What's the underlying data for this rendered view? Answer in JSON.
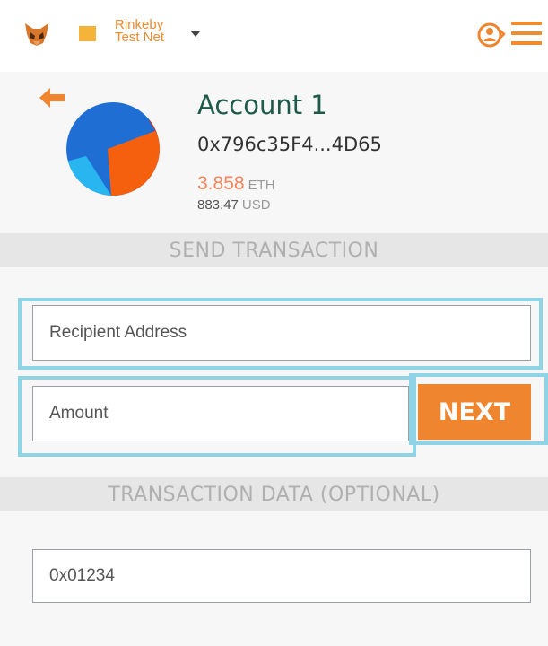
{
  "header": {
    "logo_icon": "metamask-fox-icon",
    "network": {
      "line1": "Rinkeby",
      "line2": "Test Net",
      "color": "#f5b33a"
    },
    "account_menu_icon": "user-switch-icon",
    "menu_icon": "hamburger-menu-icon"
  },
  "account": {
    "name": "Account 1",
    "address": "0x796c35F4...4D65",
    "balance_eth": "3.858",
    "eth_unit": "ETH",
    "balance_usd": "883.47",
    "usd_unit": "USD"
  },
  "send": {
    "section_title": "SEND TRANSACTION",
    "recipient_placeholder": "Recipient Address",
    "amount_placeholder": "Amount",
    "next_label": "NEXT"
  },
  "data_section": {
    "section_title": "TRANSACTION DATA (OPTIONAL)",
    "value": "0x01234"
  },
  "colors": {
    "accent": "#f08530",
    "highlight": "#8fd3e6",
    "account_name": "#1d5a4a"
  }
}
